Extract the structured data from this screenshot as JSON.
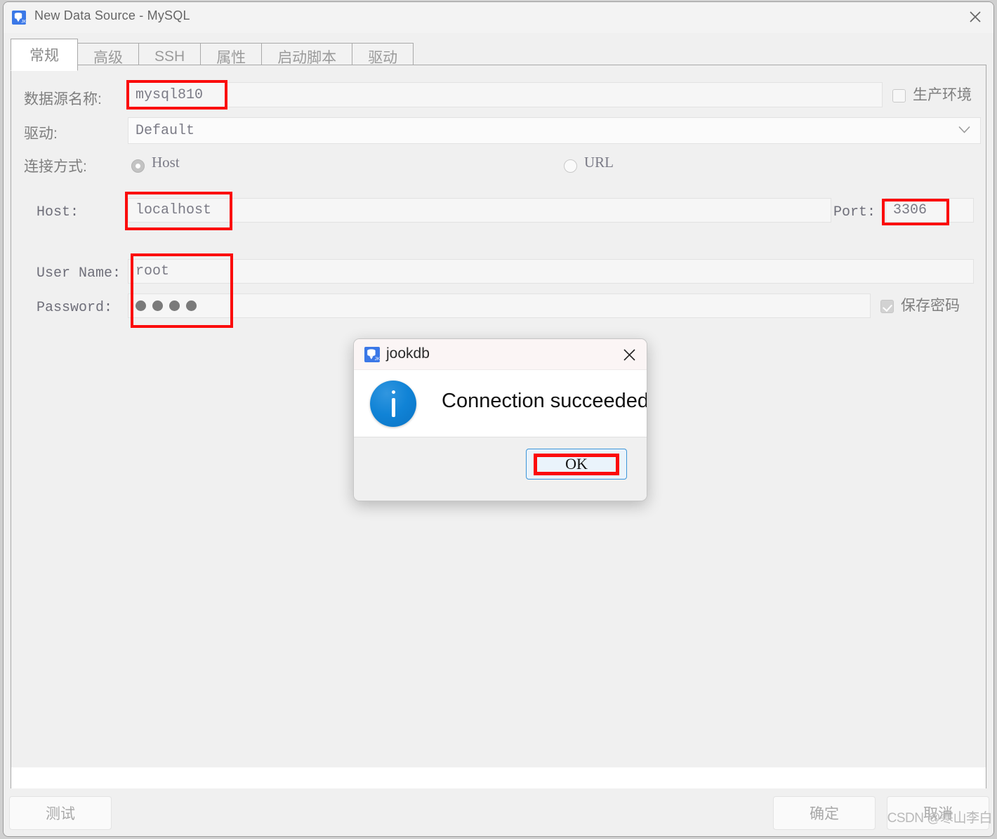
{
  "window": {
    "title": "New Data Source - MySQL",
    "icon": "database-icon",
    "close_icon": "close-icon"
  },
  "tabs": [
    {
      "label": "常规",
      "active": true
    },
    {
      "label": "高级",
      "active": false
    },
    {
      "label": "SSH",
      "active": false
    },
    {
      "label": "属性",
      "active": false
    },
    {
      "label": "启动脚本",
      "active": false
    },
    {
      "label": "驱动",
      "active": false
    }
  ],
  "form": {
    "datasource_label": "数据源名称:",
    "datasource_value": "mysql810",
    "production_checkbox_label": "生产环境",
    "production_checked": false,
    "driver_label": "驱动:",
    "driver_value": "Default",
    "conn_mode_label": "连接方式:",
    "radio_host": "Host",
    "radio_url": "URL",
    "radio_selected": "Host",
    "host_label": "Host:",
    "host_value": "localhost",
    "port_label": "Port:",
    "port_value": "3306",
    "username_label": "User Name:",
    "username_value": "root",
    "password_label": "Password:",
    "password_dots": 4,
    "save_password_label": "保存密码",
    "save_password_checked": true
  },
  "footer": {
    "test_label": "测试",
    "ok_label": "确定",
    "cancel_label": "取消",
    "watermark": "CSDN @寒山李白"
  },
  "modal": {
    "title": "jookdb",
    "icon": "database-icon",
    "close_icon": "close-icon",
    "info_icon": "info-icon",
    "message": "Connection succeeded.",
    "ok_label": "OK"
  },
  "colors": {
    "annotation": "#fb0b0b",
    "accent_blue": "#3b78e7",
    "info_blue": "#1083d6",
    "focus_blue": "#3b95d9"
  }
}
